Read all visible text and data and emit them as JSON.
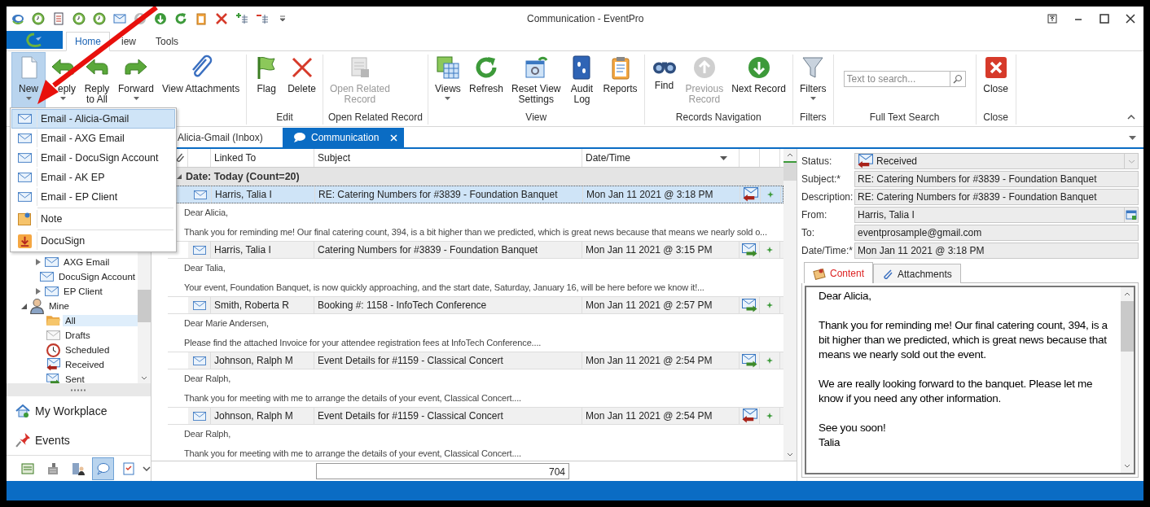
{
  "window": {
    "title": "Communication - EventPro"
  },
  "ribbon_tabs": [
    {
      "label": "Home",
      "selected": true
    },
    {
      "label": "iew",
      "selected": false
    },
    {
      "label": "Tools",
      "selected": false
    }
  ],
  "ribbon_groups": [
    {
      "buttons": [
        {
          "label": "New",
          "dropdown": true,
          "disabled": false,
          "pressed": true
        },
        {
          "label": "eply",
          "dropdown": true,
          "disabled": false,
          "pressed": false
        },
        {
          "label": "Reply\nto All",
          "dropdown": true,
          "disabled": false,
          "pressed": false
        },
        {
          "label": "Forward",
          "dropdown": true,
          "disabled": false,
          "pressed": false
        },
        {
          "label": "View Attachments",
          "dropdown": false,
          "disabled": false,
          "pressed": false
        }
      ]
    },
    {
      "label": "Edit",
      "buttons": [
        {
          "label": "Flag",
          "dropdown": false,
          "disabled": false,
          "pressed": false
        },
        {
          "label": "Delete",
          "dropdown": false,
          "disabled": false,
          "pressed": false
        }
      ]
    },
    {
      "label": "Open Related Record",
      "buttons": [
        {
          "label": "Open Related\nRecord",
          "dropdown": false,
          "disabled": true,
          "pressed": false
        }
      ]
    },
    {
      "label": "View",
      "buttons": [
        {
          "label": "Views",
          "dropdown": true,
          "disabled": false,
          "pressed": false
        },
        {
          "label": "Refresh",
          "dropdown": false,
          "disabled": false,
          "pressed": false
        },
        {
          "label": "Reset View\nSettings",
          "dropdown": false,
          "disabled": false,
          "pressed": false
        },
        {
          "label": "Audit\nLog",
          "dropdown": false,
          "disabled": false,
          "pressed": false
        },
        {
          "label": "Reports",
          "dropdown": false,
          "disabled": false,
          "pressed": false
        }
      ]
    },
    {
      "label": "Records Navigation",
      "buttons": [
        {
          "label": "Find",
          "dropdown": false,
          "disabled": false,
          "pressed": false
        },
        {
          "label": "Previous\nRecord",
          "dropdown": false,
          "disabled": true,
          "pressed": false
        },
        {
          "label": "Next Record",
          "dropdown": false,
          "disabled": false,
          "pressed": false
        }
      ]
    },
    {
      "label": "Filters",
      "buttons": [
        {
          "label": "Filters",
          "dropdown": true,
          "disabled": false,
          "pressed": false
        }
      ]
    },
    {
      "label": "Full Text Search",
      "search": {
        "placeholder": "Text to search..."
      }
    },
    {
      "label": "Close",
      "buttons": [
        {
          "label": "Close",
          "dropdown": false,
          "disabled": false,
          "pressed": false
        }
      ]
    }
  ],
  "new_menu": [
    {
      "label": "Email - Alicia-Gmail",
      "kind": "email",
      "selected": true
    },
    {
      "label": "Email - AXG Email",
      "kind": "email",
      "selected": false
    },
    {
      "label": "Email - DocuSign Account",
      "kind": "email",
      "selected": false
    },
    {
      "label": "Email - AK EP",
      "kind": "email",
      "selected": false
    },
    {
      "label": "Email - EP Client",
      "kind": "email",
      "selected": false
    },
    {
      "label": "Note",
      "kind": "note",
      "selected": false
    },
    {
      "label": "DocuSign",
      "kind": "docusign",
      "selected": false
    }
  ],
  "sidebar": {
    "tree": [
      {
        "label": "AXG Email",
        "kind": "mailbox",
        "expandable": true,
        "expanded": false,
        "selected": false
      },
      {
        "label": "DocuSign Account",
        "kind": "mailbox",
        "expandable": false,
        "selected": false
      },
      {
        "label": "EP Client",
        "kind": "mailbox",
        "expandable": true,
        "expanded": false,
        "selected": false
      },
      {
        "label": "Mine",
        "kind": "person",
        "expandable": true,
        "expanded": true,
        "selected": false,
        "children": [
          {
            "label": "All",
            "kind": "folder",
            "expandable": false,
            "selected": true
          },
          {
            "label": "Drafts",
            "kind": "draft",
            "expandable": false,
            "selected": false
          },
          {
            "label": "Scheduled",
            "kind": "clock",
            "expandable": false,
            "selected": false
          },
          {
            "label": "Received",
            "kind": "received",
            "expandable": false,
            "selected": false
          },
          {
            "label": "Sent",
            "kind": "sent",
            "expandable": false,
            "selected": false
          }
        ]
      }
    ],
    "nav": [
      {
        "label": "My Workplace",
        "kind": "home"
      },
      {
        "label": "Events",
        "kind": "pin"
      }
    ],
    "bottom_bar": [
      {
        "selected": false
      },
      {
        "selected": false
      },
      {
        "selected": false
      },
      {
        "selected": true
      },
      {
        "selected": false
      }
    ]
  },
  "doc_tabs": [
    {
      "label": "Alicia-Gmail (Inbox)",
      "selected": false,
      "closable": false
    },
    {
      "label": "Communication",
      "selected": true,
      "closable": true
    }
  ],
  "table": {
    "columns": [
      "Linked To",
      "Subject",
      "Date/Time"
    ],
    "group": "Date: Today (Count=20)",
    "rows": [
      {
        "linked_to": "Harris, Talia I",
        "subject": "RE: Catering Numbers for #3839 - Foundation Banquet",
        "datetime": "Mon Jan 11 2021 @ 3:18 PM",
        "kind": "received",
        "selected": true,
        "preview": [
          "Dear Alicia,",
          "Thank you for reminding me! Our final catering count, 394, is a bit higher than we predicted, which is great news because that means we nearly sold o..."
        ]
      },
      {
        "linked_to": "Harris, Talia I",
        "subject": "Catering Numbers for #3839 - Foundation Banquet",
        "datetime": "Mon Jan 11 2021 @ 3:15 PM",
        "kind": "sent",
        "selected": false,
        "preview": [
          "Dear Talia,",
          "Your event, Foundation Banquet, is now quickly approaching, and the start date, Saturday, January 16, will be here before we know it!..."
        ]
      },
      {
        "linked_to": "Smith, Roberta R",
        "subject": "Booking #: 1158 - InfoTech Conference",
        "datetime": "Mon Jan 11 2021 @ 2:57 PM",
        "kind": "sent",
        "selected": false,
        "preview": [
          "Dear Marie Andersen,",
          "Please find the attached Invoice for your attendee registration fees at InfoTech Conference...."
        ]
      },
      {
        "linked_to": "Johnson, Ralph M",
        "subject": "Event Details for #1159 - Classical Concert",
        "datetime": "Mon Jan 11 2021 @ 2:54 PM",
        "kind": "sent",
        "selected": false,
        "preview": [
          "Dear Ralph,",
          "Thank you for meeting with me to arrange the details of your event, Classical Concert...."
        ]
      },
      {
        "linked_to": "Johnson, Ralph M",
        "subject": "Event Details for #1159 - Classical Concert",
        "datetime": "Mon Jan 11 2021 @ 2:54 PM",
        "kind": "received",
        "selected": false,
        "preview": [
          "Dear Ralph,",
          "Thank you for meeting with me to arrange the details of your event, Classical Concert...."
        ]
      }
    ],
    "summary": "704"
  },
  "detail": {
    "fields": [
      {
        "label": "Status:",
        "value": "Received",
        "kind": "combo"
      },
      {
        "label": "Subject:*",
        "value": "RE: Catering Numbers for #3839 - Foundation Banquet",
        "kind": "text"
      },
      {
        "label": "Description:",
        "value": "RE: Catering Numbers for #3839 - Foundation Banquet",
        "kind": "text"
      },
      {
        "label": "From:",
        "value": "Harris, Talia I",
        "kind": "lookup"
      },
      {
        "label": "To:",
        "value": "eventprosample@gmail.com",
        "kind": "text"
      },
      {
        "label": "Date/Time:*",
        "value": "Mon Jan 11 2021 @ 3:18 PM",
        "kind": "text"
      }
    ],
    "tabs": [
      {
        "label": "Content",
        "selected": true
      },
      {
        "label": "Attachments",
        "selected": false
      }
    ],
    "content": [
      "Dear Alicia,",
      "Thank you for reminding me! Our final catering count, 394, is a bit higher than we predicted, which is great news because that means we nearly sold out the event.",
      "We are really looking forward to the banquet.  Please let me know if you need any other information.",
      "See you soon!\nTalia"
    ]
  },
  "annotation": {
    "kind": "arrow"
  }
}
